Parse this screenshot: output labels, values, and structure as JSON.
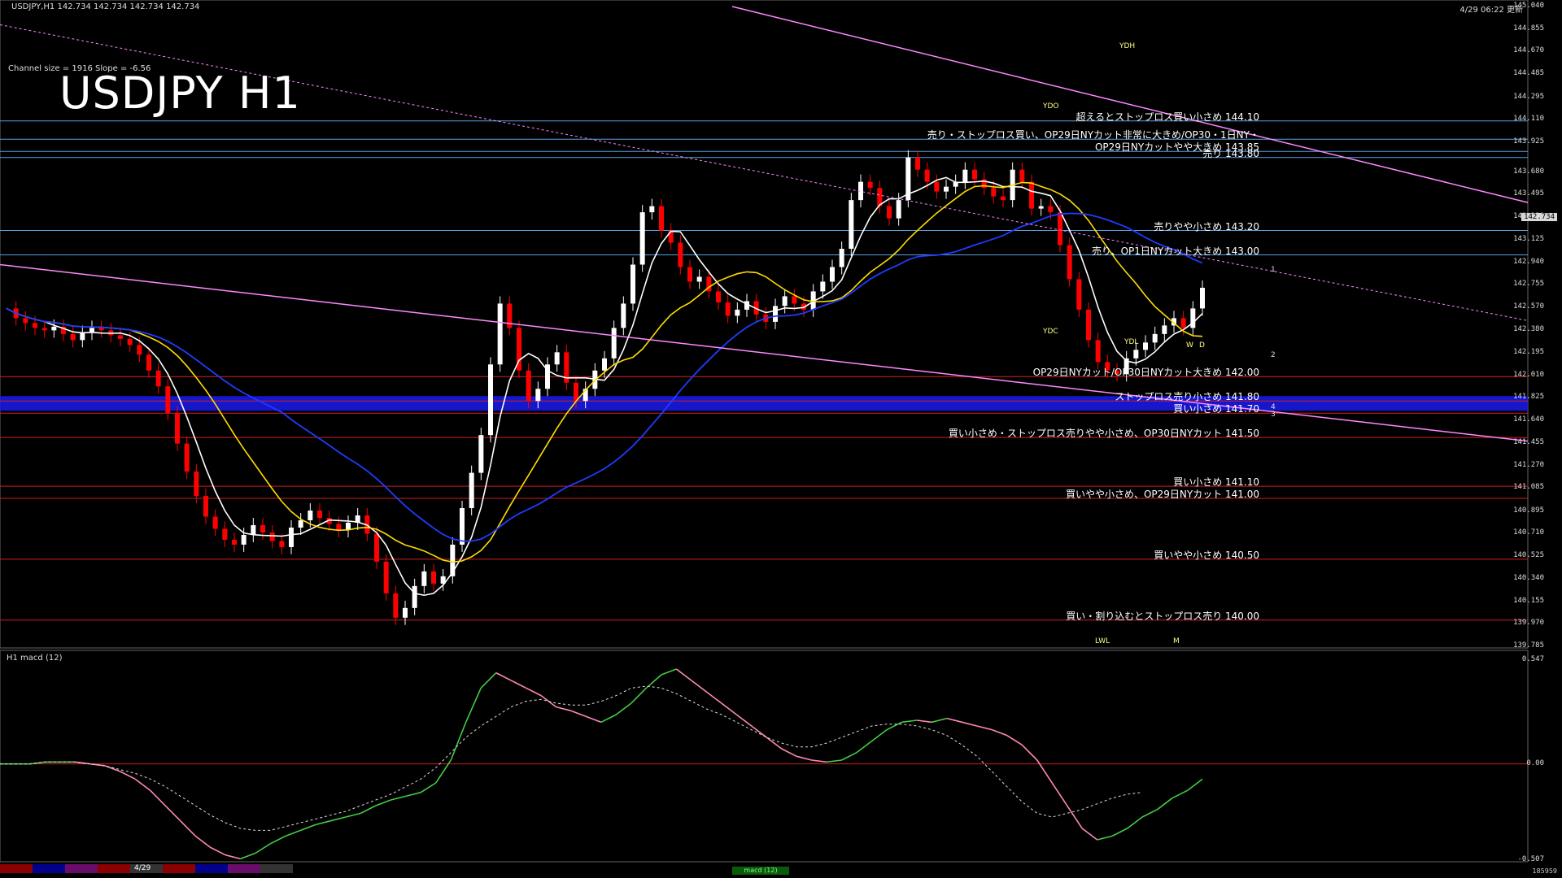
{
  "header": {
    "symbol_line": "USDJPY,H1  142.734 142.734 142.734 142.734",
    "timestamp": "4/29 06:22 更新",
    "channel_info": "Channel size = 1916 Slope = -6.56",
    "title": "USDJPY H1",
    "macd_header": "H1  macd (12)"
  },
  "chart_data": {
    "type": "candlestick",
    "title": "USDJPY H1",
    "ylim": [
      139.785,
      145.04
    ],
    "price_ticks": [
      "145.040",
      "144.855",
      "144.670",
      "144.485",
      "144.295",
      "144.110",
      "143.925",
      "143.680",
      "143.495",
      "143.310",
      "143.125",
      "142.940",
      "142.755",
      "142.570",
      "142.380",
      "142.195",
      "142.010",
      "141.825",
      "141.640",
      "141.455",
      "141.270",
      "141.085",
      "140.895",
      "140.710",
      "140.525",
      "140.340",
      "140.155",
      "139.970",
      "139.785"
    ],
    "last_price": "142.734",
    "levels": [
      {
        "price": 144.1,
        "label": "超えるとストップロス買い小さめ 144.10",
        "color": "#5aa0e0"
      },
      {
        "price": 143.95,
        "label": "売り・ストップロス買い、OP29日NYカット非常に大きめ/OP30・1日NY・",
        "color": "#5aa0e0"
      },
      {
        "price": 143.85,
        "label": "OP29日NYカットやや大きめ 143.85",
        "color": "#5aa0e0"
      },
      {
        "price": 143.8,
        "label": "売り 143.80",
        "color": "#5aa0e0"
      },
      {
        "price": 143.2,
        "label": "売りやや小さめ 143.20",
        "color": "#5aa0e0"
      },
      {
        "price": 143.0,
        "label": "売り、OP1日NYカット大きめ 143.00",
        "color": "#5aa0e0"
      },
      {
        "price": 142.0,
        "label": "OP29日NYカット/OP30日NYカット大きめ 142.00",
        "color": "#d02020"
      },
      {
        "price": 141.8,
        "label": "ストップロス売り小さめ 141.80",
        "color": "#d02020"
      },
      {
        "price": 141.7,
        "label": "買い小さめ 141.70",
        "color": "#d02020"
      },
      {
        "price": 141.5,
        "label": "買い小さめ・ストップロス売りやや小さめ、OP30日NYカット 141.50",
        "color": "#d02020"
      },
      {
        "price": 141.1,
        "label": "買い小さめ 141.10",
        "color": "#d02020"
      },
      {
        "price": 141.0,
        "label": "買いやや小さめ、OP29日NYカット 141.00",
        "color": "#d02020"
      },
      {
        "price": 140.5,
        "label": "買いやや小さめ 140.50",
        "color": "#d02020"
      },
      {
        "price": 140.0,
        "label": "買い・割り込むとストップロス売り 140.00",
        "color": "#d02020"
      }
    ],
    "close_series": [
      142.56,
      142.48,
      142.44,
      142.4,
      142.38,
      142.41,
      142.35,
      142.3,
      142.36,
      142.4,
      142.38,
      142.34,
      142.31,
      142.26,
      142.18,
      142.05,
      141.92,
      141.7,
      141.45,
      141.22,
      141.02,
      140.85,
      140.75,
      140.66,
      140.62,
      140.7,
      140.78,
      140.72,
      140.65,
      140.6,
      140.76,
      140.82,
      140.9,
      140.84,
      140.79,
      140.74,
      140.8,
      140.86,
      140.71,
      140.48,
      140.22,
      140.02,
      140.1,
      140.28,
      140.4,
      140.3,
      140.36,
      140.62,
      140.92,
      141.21,
      141.52,
      142.1,
      142.6,
      142.4,
      142.05,
      141.8,
      141.9,
      142.1,
      142.2,
      141.95,
      141.8,
      141.9,
      142.05,
      142.15,
      142.4,
      142.6,
      142.92,
      143.35,
      143.4,
      143.2,
      143.1,
      142.9,
      142.78,
      142.82,
      142.7,
      142.61,
      142.5,
      142.55,
      142.62,
      142.51,
      142.45,
      142.58,
      142.66,
      142.6,
      142.55,
      142.7,
      142.78,
      142.9,
      143.05,
      143.45,
      143.6,
      143.55,
      143.4,
      143.3,
      143.45,
      143.8,
      143.7,
      143.6,
      143.52,
      143.56,
      143.6,
      143.7,
      143.62,
      143.55,
      143.48,
      143.45,
      143.7,
      143.6,
      143.38,
      143.4,
      143.35,
      143.08,
      142.8,
      142.55,
      142.3,
      142.12,
      142.05,
      142.02,
      142.15,
      142.22,
      142.28,
      142.35,
      142.42,
      142.48,
      142.4,
      142.56,
      142.73
    ],
    "annotations": [
      "YDO",
      "YDH",
      "YDC",
      "YDL",
      "LWL",
      "W",
      "D",
      "M",
      "1",
      "2",
      "3",
      "4"
    ],
    "macd_ticks": [
      "0.547",
      "0.00",
      "-0.507"
    ],
    "macd_series": [
      0.0,
      0.0,
      0.0,
      0.01,
      0.01,
      0.01,
      0.0,
      -0.01,
      -0.04,
      -0.08,
      -0.14,
      -0.22,
      -0.3,
      -0.38,
      -0.44,
      -0.48,
      -0.5,
      -0.47,
      -0.42,
      -0.38,
      -0.35,
      -0.32,
      -0.3,
      -0.28,
      -0.26,
      -0.22,
      -0.19,
      -0.17,
      -0.15,
      -0.1,
      0.02,
      0.22,
      0.4,
      0.48,
      0.44,
      0.4,
      0.36,
      0.3,
      0.28,
      0.25,
      0.22,
      0.26,
      0.32,
      0.4,
      0.47,
      0.5,
      0.44,
      0.38,
      0.32,
      0.26,
      0.2,
      0.14,
      0.08,
      0.04,
      0.02,
      0.01,
      0.02,
      0.06,
      0.12,
      0.18,
      0.22,
      0.23,
      0.22,
      0.24,
      0.22,
      0.2,
      0.18,
      0.15,
      0.1,
      0.02,
      -0.1,
      -0.22,
      -0.34,
      -0.4,
      -0.38,
      -0.34,
      -0.28,
      -0.24,
      -0.18,
      -0.14,
      -0.08
    ],
    "signal_series": [
      0.0,
      0.0,
      0.0,
      0.01,
      0.01,
      0.01,
      0.0,
      -0.01,
      -0.03,
      -0.05,
      -0.08,
      -0.12,
      -0.17,
      -0.22,
      -0.27,
      -0.31,
      -0.34,
      -0.35,
      -0.35,
      -0.33,
      -0.31,
      -0.29,
      -0.27,
      -0.25,
      -0.22,
      -0.19,
      -0.16,
      -0.12,
      -0.08,
      -0.02,
      0.06,
      0.14,
      0.2,
      0.25,
      0.3,
      0.33,
      0.34,
      0.32,
      0.31,
      0.31,
      0.33,
      0.36,
      0.4,
      0.41,
      0.4,
      0.37,
      0.33,
      0.29,
      0.26,
      0.22,
      0.18,
      0.14,
      0.11,
      0.09,
      0.09,
      0.11,
      0.14,
      0.17,
      0.2,
      0.21,
      0.21,
      0.2,
      0.18,
      0.15,
      0.1,
      0.04,
      -0.04,
      -0.12,
      -0.2,
      -0.26,
      -0.28,
      -0.26,
      -0.24,
      -0.21,
      -0.18,
      -0.16,
      -0.15
    ]
  },
  "footer": {
    "date_mark": "4/29",
    "macd_tab": "macd (12)",
    "corner_num": "185959",
    "strip_colors": [
      "#8b0000",
      "#00008b",
      "#6a0d6a",
      "#8b0000",
      "#333333",
      "#8b0000",
      "#00008b",
      "#6a0d6a",
      "#333333"
    ]
  },
  "colors": {
    "bull": "#ffffff",
    "bear": "#ff0000",
    "ma_fast": "#ffffff",
    "ma_mid": "#ffdd00",
    "ma_slow": "#1e3cff",
    "trend_line": "#ff88ff",
    "macd": "#44cc44",
    "macd_neg": "#ff88bb",
    "signal": "#dddddd"
  }
}
